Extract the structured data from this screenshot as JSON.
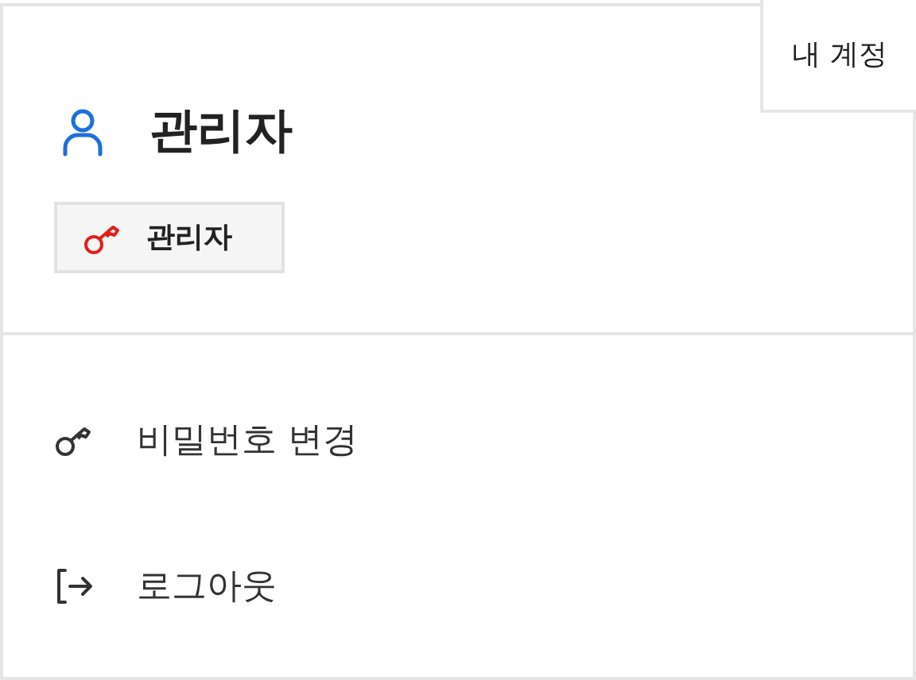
{
  "tab": {
    "label": "내 계정"
  },
  "profile": {
    "name": "관리자",
    "role_badge": "관리자"
  },
  "menu": [
    {
      "kind": "password",
      "label": "비밀번호 변경"
    },
    {
      "kind": "logout",
      "label": "로그아웃"
    }
  ]
}
